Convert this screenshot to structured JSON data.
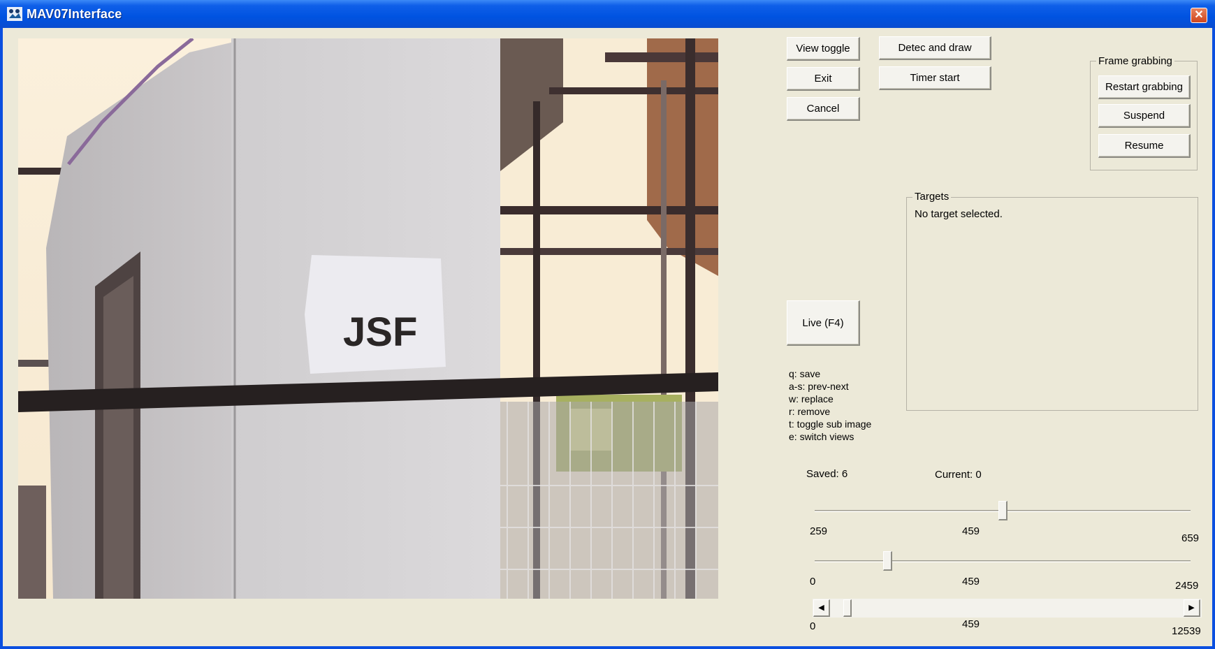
{
  "window": {
    "title": "MAV07Interface",
    "close_glyph": "✕"
  },
  "buttons": {
    "view_toggle": "View toggle",
    "exit": "Exit",
    "cancel": "Cancel",
    "detec_and_draw": "Detec and draw",
    "timer_start": "Timer start",
    "live": "Live (F4)"
  },
  "frame_grabbing": {
    "title": "Frame grabbing",
    "restart": "Restart grabbing",
    "suspend": "Suspend",
    "resume": "Resume"
  },
  "targets": {
    "title": "Targets",
    "status": "No target selected."
  },
  "video": {
    "sign_text": "JSF"
  },
  "help": [
    "q: save",
    "a-s: prev-next",
    "w: replace",
    "r: remove",
    "t: toggle sub image",
    "e: switch views"
  ],
  "counters": {
    "saved": "Saved: 6",
    "current": "Current: 0"
  },
  "sliders": [
    {
      "min": "259",
      "value": "459",
      "max": "659",
      "position": 0.5
    },
    {
      "min": "0",
      "value": "459",
      "max": "2459",
      "position": 0.1867
    },
    {
      "min": "0",
      "value": "459",
      "max": "12539",
      "position": 0.0366
    }
  ],
  "scroll_arrows": {
    "left": "◀",
    "right": "▶"
  }
}
